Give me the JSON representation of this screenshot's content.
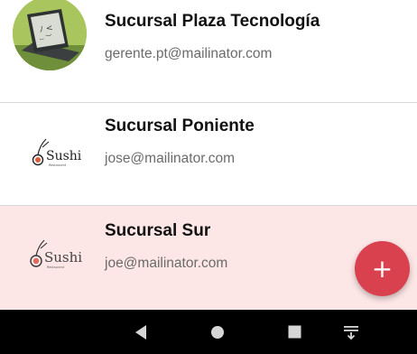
{
  "colors": {
    "selected_row_bg": "#fde6e6",
    "fab_bg": "#d9414f",
    "navbar_bg": "#000000",
    "nav_icon": "#d6d6d6"
  },
  "branches": [
    {
      "name": "Sucursal Plaza Tecnología",
      "email": "gerente.pt@mailinator.com",
      "avatar_icon": "laptop-photo-icon",
      "selected": false
    },
    {
      "name": "Sucursal Poniente",
      "email": "jose@mailinator.com",
      "avatar_icon": "sushi-logo-icon",
      "avatar_logo_text": "Sushi",
      "avatar_logo_subtext": "Restaurant",
      "selected": false
    },
    {
      "name": "Sucursal Sur",
      "email": "joe@mailinator.com",
      "avatar_icon": "sushi-logo-icon",
      "avatar_logo_text": "Sushi",
      "avatar_logo_subtext": "Restaurant",
      "selected": true
    }
  ],
  "fab": {
    "label": "+",
    "icon": "plus-icon"
  },
  "navbar": {
    "buttons": [
      "back-icon",
      "home-icon",
      "recents-icon",
      "notification-drawer-icon"
    ]
  }
}
